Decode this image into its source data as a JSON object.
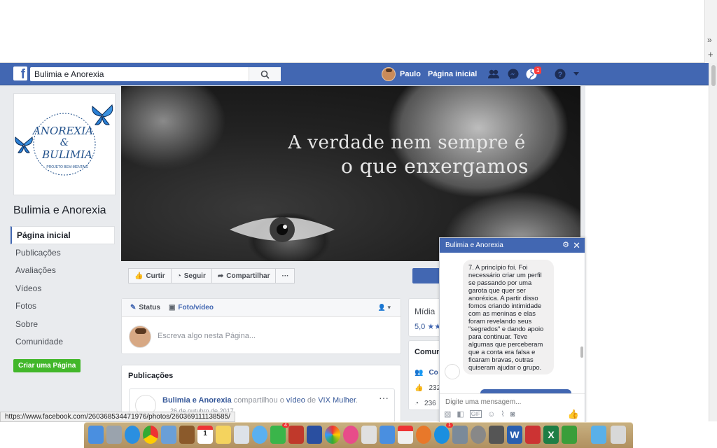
{
  "browser": {},
  "topbar": {
    "search_value": "Bulimia e Anorexia",
    "user_name": "Paulo",
    "home_label": "Página inicial",
    "notification_count": "1"
  },
  "page": {
    "name": "Bulimia e Anorexia",
    "logo_text_1": "ANOREXIA",
    "logo_text_2": "&",
    "logo_text_3": "BULIMIA",
    "logo_sub": "PROJETO BEM-MENTAIS",
    "nav": [
      {
        "label": "Página inicial",
        "active": true
      },
      {
        "label": "Publicações"
      },
      {
        "label": "Avaliações"
      },
      {
        "label": "Vídeos"
      },
      {
        "label": "Fotos"
      },
      {
        "label": "Sobre"
      },
      {
        "label": "Comunidade"
      }
    ],
    "create_button": "Criar uma Página"
  },
  "cover": {
    "line1": "A verdade nem sempre é",
    "line2": "o que enxergamos"
  },
  "actions": {
    "like": "Curtir",
    "follow": "Seguir",
    "share": "Compartilhar",
    "more": "···"
  },
  "composer": {
    "tab_status": "Status",
    "tab_photo": "Foto/vídeo",
    "placeholder": "Escreva algo nesta Página..."
  },
  "publications": {
    "title": "Publicações",
    "post_author": "Bulimia e Anorexia",
    "post_action": "compartilhou o",
    "post_object": "vídeo",
    "post_prep": "de",
    "post_source": "VIX Mulher",
    "post_date": "26 de outubro de 2017"
  },
  "sidebar_right": {
    "media_label": "Mídia",
    "rating": "5,0",
    "community_label": "Comun",
    "community_link": "Co",
    "likes": "232",
    "follows": "236"
  },
  "chat": {
    "title": "Bulimia e Anorexia",
    "message": "7. A princípio foi. Foi necessário criar um perfil se passando por uma garota que quer ser anoréxica. A partir disso fomos criando intimidade com as meninas e elas foram revelando seus \"segredos\" e dando apoio para continuar. Teve algumas que perceberam que a conta era falsa e ficaram bravas, outras quiseram ajudar o grupo.",
    "input_placeholder": "Digite uma mensagem..."
  },
  "statusbar": {
    "url": "https://www.facebook.com/260368534471976/photos/260369111138585/"
  },
  "dock": {
    "badge_1": "4",
    "badge_2": "1"
  },
  "colors": {
    "fb_blue": "#4267b2",
    "bg_gray": "#e9ebee",
    "green": "#42b72a"
  }
}
